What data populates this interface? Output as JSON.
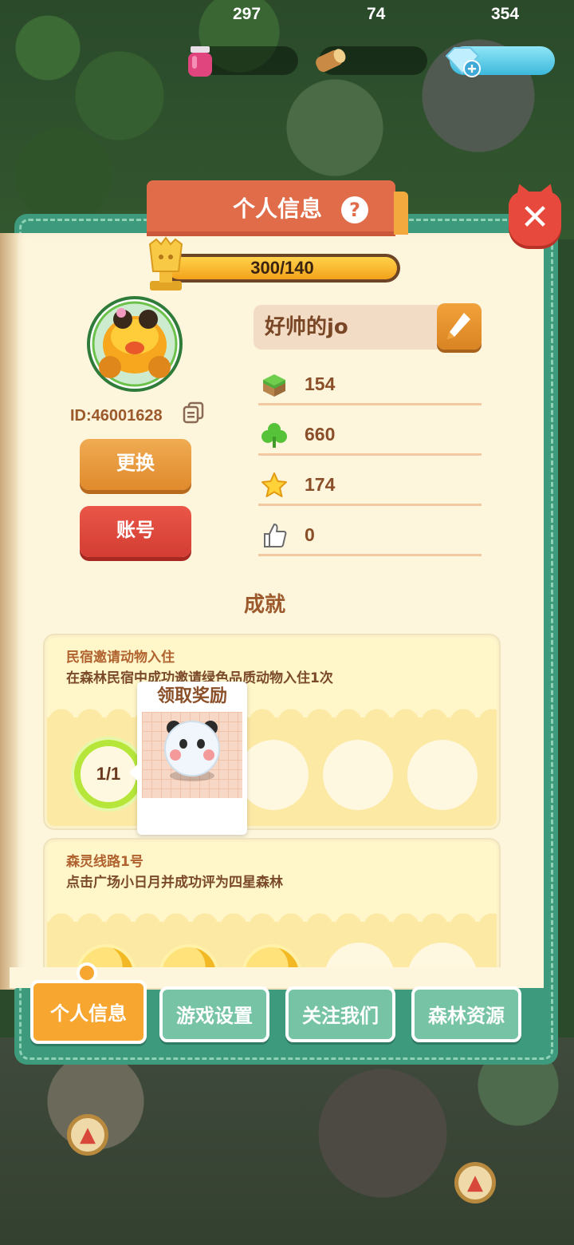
{
  "resources": {
    "jam": {
      "icon": "jam-jar-icon",
      "value": "297"
    },
    "wood": {
      "icon": "wood-log-icon",
      "value": "74"
    },
    "gems": {
      "icon": "diamond-icon",
      "value": "354"
    }
  },
  "panel": {
    "title": "个人信息",
    "help_label": "?",
    "close_label": "✕"
  },
  "profile": {
    "level_progress_text": "300/140",
    "level_fill": 1.0,
    "user_id": "ID:46001628",
    "change_button": "更换",
    "account_button": "账号",
    "nickname": "好帅的jo",
    "stats": [
      {
        "icon": "grass-block-icon",
        "value": "154"
      },
      {
        "icon": "clover-icon",
        "value": "660"
      },
      {
        "icon": "star-icon",
        "value": "174"
      },
      {
        "icon": "thumbs-up-icon",
        "value": "0"
      }
    ]
  },
  "achievements": {
    "section_title": "成就",
    "items": [
      {
        "title": "民宿邀请动物入住",
        "description": "在森林民宿中成功邀请绿色品质动物入住1次",
        "progress": "1/1",
        "popup_title": "领取奖励"
      },
      {
        "title": "森灵线路1号",
        "description": "点击广场小日月并成功评为四星森林"
      }
    ]
  },
  "tabs": [
    {
      "label": "个人信息",
      "active": true
    },
    {
      "label": "游戏设置",
      "active": false
    },
    {
      "label": "关注我们",
      "active": false
    },
    {
      "label": "森林资源",
      "active": false
    }
  ],
  "colors": {
    "accent_orange": "#f7a630",
    "tab_green": "#76c4a5",
    "panel_green": "#3d9a7c",
    "title_red": "#e06c4a",
    "close_red": "#e8493d"
  }
}
